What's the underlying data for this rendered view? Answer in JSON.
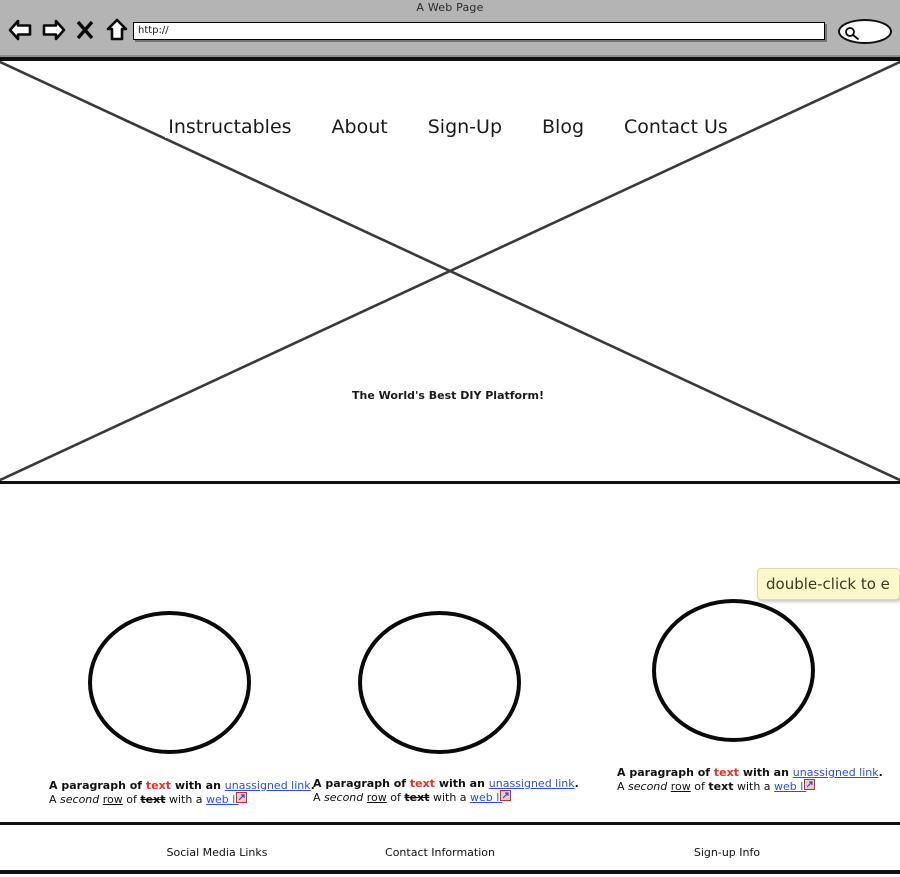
{
  "browser": {
    "window_title": "A Web Page",
    "url_value": "http://",
    "url_placeholder": "http://",
    "search_placeholder": "",
    "search_value": "",
    "icons": {
      "back": "back-arrow-icon",
      "forward": "forward-arrow-icon",
      "stop": "close-x-icon",
      "home": "home-icon",
      "search": "search-magnifier-icon"
    }
  },
  "hero": {
    "nav_items": [
      {
        "label": "Instructables"
      },
      {
        "label": "About"
      },
      {
        "label": "Sign-Up"
      },
      {
        "label": "Blog"
      },
      {
        "label": "Contact Us"
      }
    ],
    "tagline": "The World's Best DIY Platform!"
  },
  "tooltip": {
    "text": "double-click to e"
  },
  "columns": [
    {
      "circle_name": "placeholder-circle-1",
      "line1": {
        "a": "A paragraph of ",
        "text": "text",
        "b": " with an ",
        "link": "unassigned link",
        "c": "."
      },
      "line2": {
        "a": "A ",
        "italic": "second",
        "b": " ",
        "underline": "row",
        "c": " of ",
        "strike": "text",
        "d": " with a ",
        "link": "web li",
        "strikethrough_on": true
      }
    },
    {
      "circle_name": "placeholder-circle-2",
      "line1": {
        "a": "A paragraph of ",
        "text": "text",
        "b": " with an ",
        "link": "unassigned link",
        "c": "."
      },
      "line2": {
        "a": "A ",
        "italic": "second",
        "b": " ",
        "underline": "row",
        "c": " of ",
        "strike": "text",
        "d": " with a ",
        "link": "web li",
        "strikethrough_on": true
      }
    },
    {
      "circle_name": "placeholder-circle-3",
      "line1": {
        "a": "A paragraph of ",
        "text": "text",
        "b": " with an ",
        "link": "unassigned link",
        "c": "."
      },
      "line2": {
        "a": "A ",
        "italic": "second",
        "b": " ",
        "underline": "row",
        "c": " of ",
        "strike": "text",
        "d": " with a ",
        "link": "web li",
        "strikethrough_on": false
      }
    }
  ],
  "footer": {
    "col1": "Social Media Links",
    "col2": "Contact Information",
    "col3": "Sign-up Info"
  },
  "colors": {
    "chrome_gray": "#b4b4b4",
    "accent_red": "#e8312a",
    "link_blue": "#2b4fdb",
    "tooltip_yellow": "#fbf8cc",
    "ink": "#111111"
  }
}
